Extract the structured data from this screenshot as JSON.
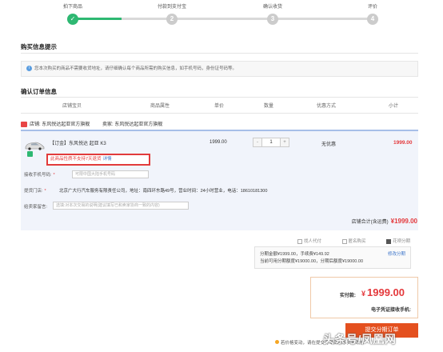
{
  "steps": [
    {
      "label": "拍下商品",
      "num": "✓",
      "active": true
    },
    {
      "label": "付款到支付宝",
      "num": "2",
      "active": false
    },
    {
      "label": "确认收货",
      "num": "3",
      "active": false
    },
    {
      "label": "评价",
      "num": "4",
      "active": false
    }
  ],
  "purchase_info": {
    "title": "购买信息提示",
    "notice": "您本次购买的商品不需要收货地址，请仔细确认每个商品所需的购买信息，如手机号码，身份证号码等。"
  },
  "order": {
    "title": "确认订单信息",
    "columns": {
      "product": "店铺宝贝",
      "attr": "商品属性",
      "price": "单价",
      "qty": "数量",
      "promo": "优惠方式",
      "subtotal": "小计"
    },
    "shop_label": "店铺: 东风悦达起亚官方旗舰",
    "seller_label": "卖家: 东风悦达起亚官方旗舰",
    "product_name": "【订金】东风悦达 起亚 K3",
    "price": "1999.00",
    "qty": "1",
    "qty_minus": "-",
    "qty_plus": "+",
    "promo": "无优惠",
    "subtotal": "1999.00",
    "warning": "此商品性质不支持7天退货",
    "warning_link": "详情",
    "phone_label": "接收手机号码:",
    "phone_required": "*",
    "phone_placeholder": "可限中国大陆手机号码",
    "store_label": "提货门店:",
    "store_required": "*",
    "store_text": "北京广大行汽车服务有限责任公司，地址：南四环东路49号，营业时间：24小时营业，电话：18610181300",
    "message_label": "给卖家留言:",
    "message_placeholder": "选填:对本次交易的说明(建议填写已和卖家协商一致的内容)",
    "shop_total_label": "店铺合计(含运费)",
    "shop_total": "¥1999.00"
  },
  "options": {
    "proxy": "找人代付",
    "anon": "匿名购买",
    "installment": "花呗分期"
  },
  "installment": {
    "line1": "分期金额¥1999.00，手续费¥149.92",
    "line2": "当前可用分期额度¥19000.00，分期后额度¥19000.00",
    "edit": "修改分期"
  },
  "payment": {
    "label": "实付款:",
    "currency": "¥",
    "amount": "1999.00",
    "phone_label": "电子凭证接收手机:"
  },
  "submit": "提交分期订单",
  "tip": "若价格变动，请在提交订单后联系卖家改价",
  "watermark": "头条号/凤凰网",
  "colors": {
    "accent_green": "#2eb872",
    "price_red": "#e4393c",
    "submit_orange": "#e4501f",
    "link_blue": "#3a73c9"
  }
}
